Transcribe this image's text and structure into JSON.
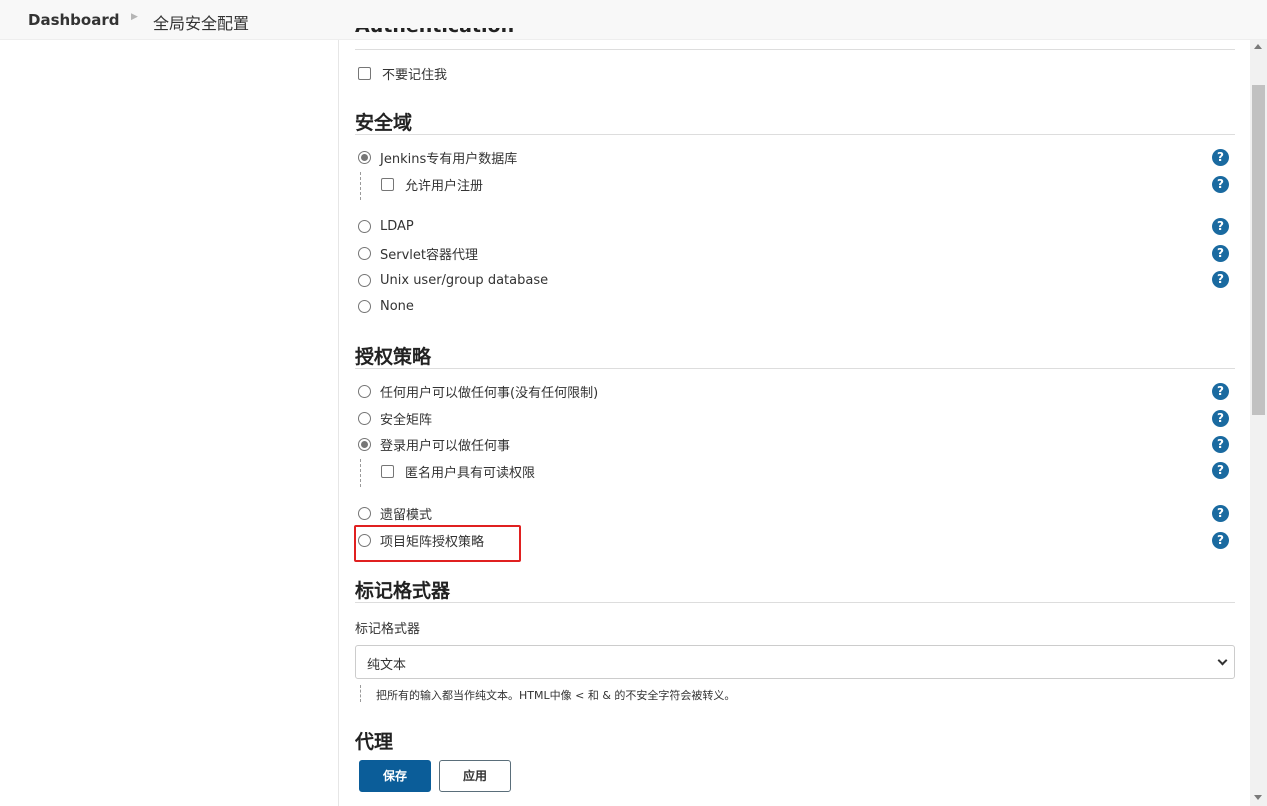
{
  "breadcrumb": {
    "home": "Dashboard",
    "current": "全局安全配置"
  },
  "authentication": {
    "title": "Authentication",
    "remember_me": {
      "label": "不要记住我",
      "checked": false
    }
  },
  "security_realm": {
    "title": "安全域",
    "options": [
      {
        "label": "Jenkins专有用户数据库",
        "selected": true
      },
      {
        "label": "LDAP",
        "selected": false
      },
      {
        "label": "Servlet容器代理",
        "selected": false
      },
      {
        "label": "Unix user/group database",
        "selected": false
      },
      {
        "label": "None",
        "selected": false
      }
    ],
    "allow_signup": {
      "label": "允许用户注册",
      "checked": false
    }
  },
  "authorization": {
    "title": "授权策略",
    "options": [
      {
        "label": "任何用户可以做任何事(没有任何限制)",
        "selected": false
      },
      {
        "label": "安全矩阵",
        "selected": false
      },
      {
        "label": "登录用户可以做任何事",
        "selected": true
      },
      {
        "label": "遗留模式",
        "selected": false
      },
      {
        "label": "项目矩阵授权策略",
        "selected": false
      }
    ],
    "anonymous_read": {
      "label": "匿名用户具有可读权限",
      "checked": false
    }
  },
  "markup_formatter": {
    "title": "标记格式器",
    "field_label": "标记格式器",
    "selected": "纯文本",
    "description": "把所有的输入都当作纯文本。HTML中像 < 和 & 的不安全字符会被转义。"
  },
  "proxy": {
    "title": "代理"
  },
  "buttons": {
    "save": "保存",
    "apply": "应用"
  },
  "icons": {
    "help": "?"
  },
  "colors": {
    "primary": "#0b5d99",
    "help": "#1a6aa0",
    "highlight": "#e02020"
  }
}
